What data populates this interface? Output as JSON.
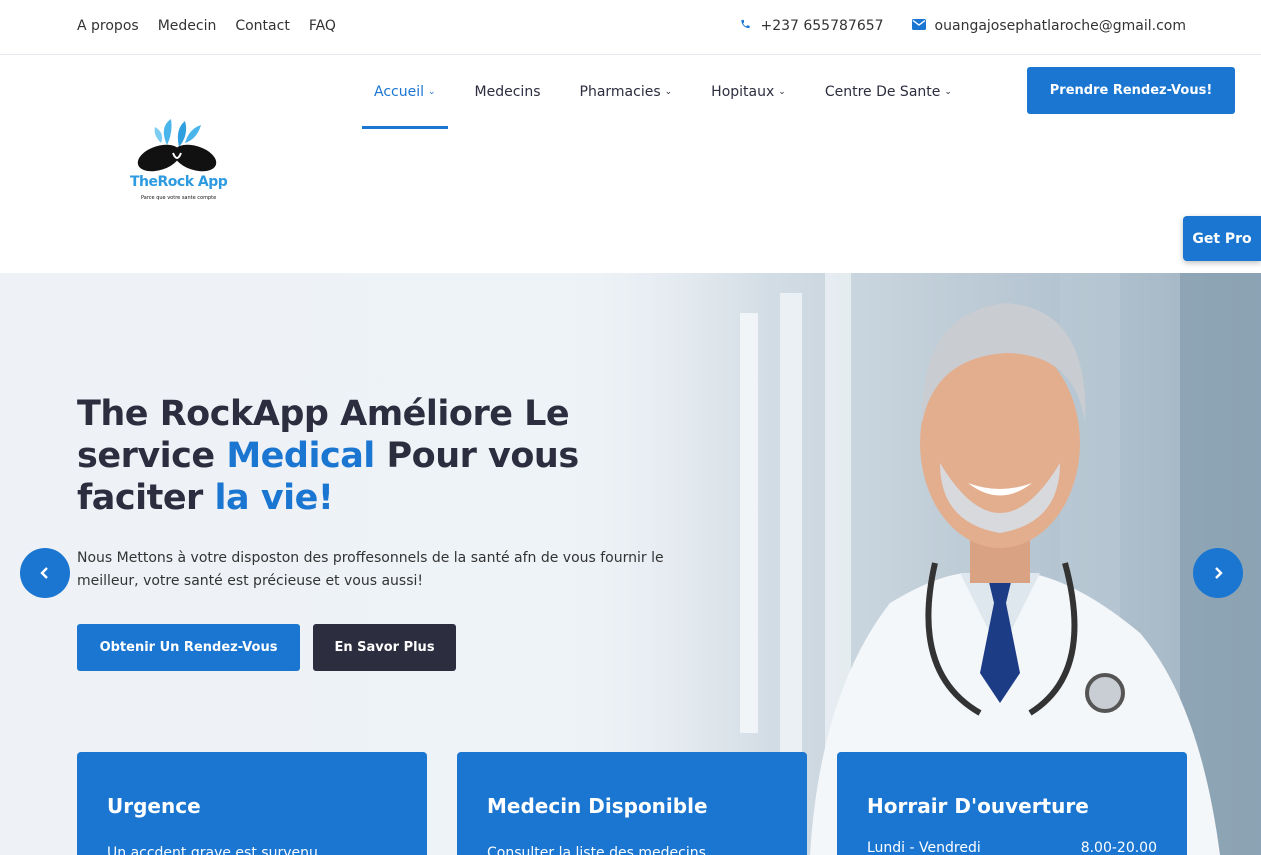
{
  "topbar": {
    "links": [
      "A propos",
      "Medecin",
      "Contact",
      "FAQ"
    ],
    "phone": "+237 655787657",
    "email": "ouangajosephatlaroche@gmail.com"
  },
  "logo": {
    "name": "TheRock App",
    "tagline": "Parce que votre sante compte"
  },
  "nav": {
    "items": [
      {
        "label": "Accueil",
        "active": true,
        "dropdown": true
      },
      {
        "label": "Medecins",
        "active": false,
        "dropdown": false
      },
      {
        "label": "Pharmacies",
        "active": false,
        "dropdown": true
      },
      {
        "label": "Hopitaux",
        "active": false,
        "dropdown": true
      },
      {
        "label": "Centre De Sante",
        "active": false,
        "dropdown": true
      }
    ],
    "cta": "Prendre Rendez-Vous!"
  },
  "get_pro": "Get Pro",
  "hero": {
    "title_1": "The RockApp Améliore Le service ",
    "title_hl1": "Medical",
    "title_2": " Pour vous faciter ",
    "title_hl2": "la vie!",
    "text": "Nous Mettons à votre disposton des proffesonnels de la santé afn de vous fournir le meilleur, votre santé est précieuse et vous aussi!",
    "btn_primary": "Obtenir Un Rendez-Vous",
    "btn_secondary": "En Savor Plus"
  },
  "cards": [
    {
      "title": "Urgence",
      "text": "Un accdent grave est survenu"
    },
    {
      "title": "Medecin Disponible",
      "text": "Consulter la liste des medecins"
    },
    {
      "title": "Horrair D'ouverture",
      "day": "Lundi - Vendredi",
      "time": "8.00-20.00"
    }
  ],
  "colors": {
    "accent": "#1a76d1",
    "dark": "#2c2d3f",
    "logo_blue": "#2e9ae0"
  }
}
